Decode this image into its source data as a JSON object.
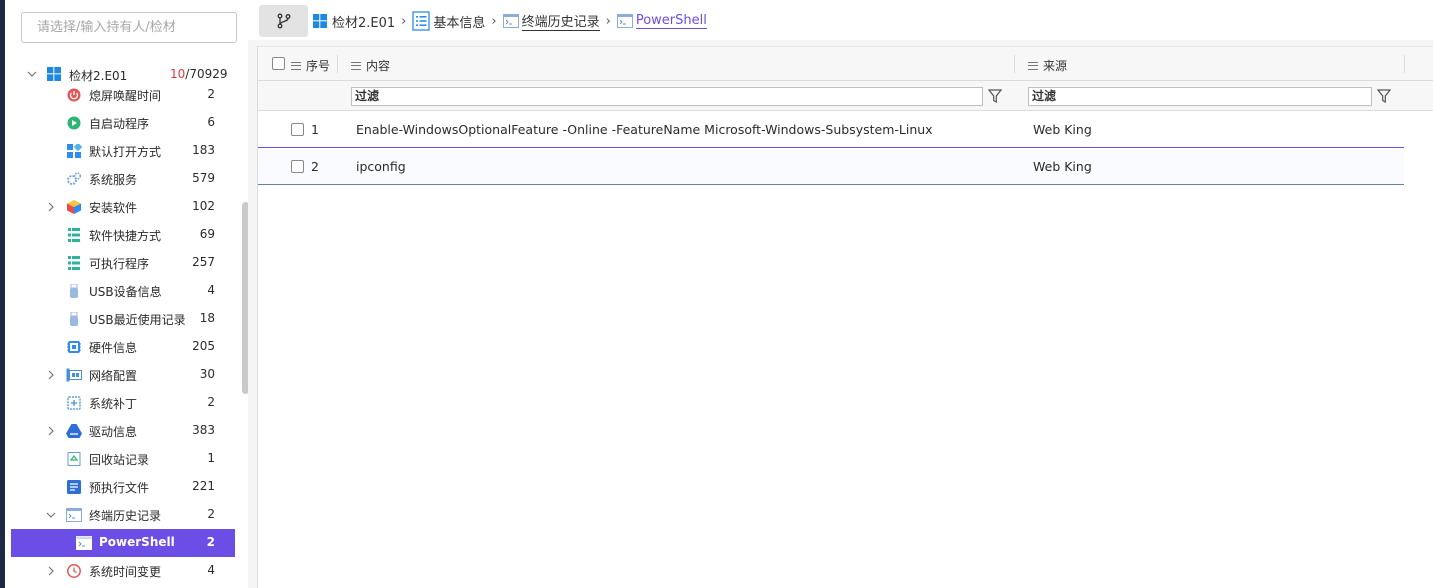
{
  "sidebar": {
    "search_placeholder": "请选择/输入持有人/检材",
    "root": {
      "label": "检材2.E01",
      "count_highlight": "10",
      "count_total": "/70929"
    },
    "items": [
      {
        "label": "熄屏唤醒时间",
        "count": "2",
        "icon": "power-icon",
        "color": "#e45656",
        "expandable": false
      },
      {
        "label": "自启动程序",
        "count": "6",
        "icon": "play-icon",
        "color": "#2bb673",
        "expandable": false
      },
      {
        "label": "默认打开方式",
        "count": "183",
        "icon": "grid-icon",
        "color": "#2d8cf0",
        "expandable": false
      },
      {
        "label": "系统服务",
        "count": "579",
        "icon": "cogs-icon",
        "color": "#7aa7d6",
        "expandable": false
      },
      {
        "label": "安装软件",
        "count": "102",
        "icon": "cube-icon",
        "color": "#f2a93b",
        "expandable": true
      },
      {
        "label": "软件快捷方式",
        "count": "69",
        "icon": "list-icon",
        "color": "#2bb3a0",
        "expandable": false
      },
      {
        "label": "可执行程序",
        "count": "257",
        "icon": "list-icon",
        "color": "#2bb3a0",
        "expandable": false
      },
      {
        "label": "USB设备信息",
        "count": "4",
        "icon": "usb-icon",
        "color": "#9bb8e0",
        "expandable": false
      },
      {
        "label": "USB最近使用记录",
        "count": "18",
        "icon": "usb-icon",
        "color": "#9bb8e0",
        "expandable": false
      },
      {
        "label": "硬件信息",
        "count": "205",
        "icon": "chip-icon",
        "color": "#2d8cf0",
        "expandable": false
      },
      {
        "label": "网络配置",
        "count": "30",
        "icon": "network-icon",
        "color": "#4a90d9",
        "expandable": true
      },
      {
        "label": "系统补丁",
        "count": "2",
        "icon": "patch-icon",
        "color": "#5aa0e0",
        "expandable": false
      },
      {
        "label": "驱动信息",
        "count": "383",
        "icon": "drive-icon",
        "color": "#2d6fd6",
        "expandable": true
      },
      {
        "label": "回收站记录",
        "count": "1",
        "icon": "recycle-icon",
        "color": "#6a9fd8",
        "expandable": false
      },
      {
        "label": "预执行文件",
        "count": "221",
        "icon": "doc-icon",
        "color": "#2d6fd6",
        "expandable": false
      },
      {
        "label": "终端历史记录",
        "count": "2",
        "icon": "terminal-icon",
        "color": "#8aaed6",
        "expandable": "open"
      },
      {
        "label": "PowerShell",
        "count": "2",
        "icon": "terminal-icon",
        "color": "#ffffff",
        "expandable": false,
        "selected": true
      },
      {
        "label": "系统时间变更",
        "count": "4",
        "icon": "clock-icon",
        "color": "#e45656",
        "expandable": true
      }
    ]
  },
  "breadcrumb": [
    {
      "label": "检材2.E01",
      "icon": "windows-icon"
    },
    {
      "label": "基本信息",
      "icon": "list-icon"
    },
    {
      "label": "终端历史记录",
      "icon": "terminal-icon"
    },
    {
      "label": "PowerShell",
      "icon": "terminal-icon"
    }
  ],
  "table": {
    "columns": {
      "index": "序号",
      "content": "内容",
      "source": "来源"
    },
    "filter_placeholder": "过滤",
    "rows": [
      {
        "index": "1",
        "content": "Enable-WindowsOptionalFeature -Online -FeatureName Microsoft-Windows-Subsystem-Linux",
        "source": "Web King"
      },
      {
        "index": "2",
        "content": "ipconfig",
        "source": "Web King"
      }
    ]
  },
  "colors": {
    "accent": "#6b4ee6",
    "count_highlight": "#e0383e"
  }
}
